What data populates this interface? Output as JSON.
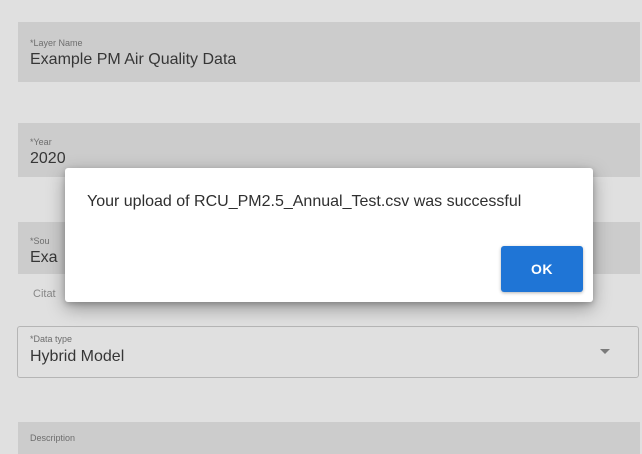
{
  "form": {
    "layer_name": {
      "label": "*Layer Name",
      "value": "Example PM Air Quality Data"
    },
    "year": {
      "label": "*Year",
      "value": "2020"
    },
    "source": {
      "label": "*Sou",
      "value": "Exa"
    },
    "citation_helper": "Citat",
    "data_type": {
      "label": "*Data type",
      "value": "Hybrid Model"
    },
    "description": {
      "label": "Description",
      "value": ""
    }
  },
  "dialog": {
    "message": "Your upload of RCU_PM2.5_Annual_Test.csv was successful",
    "ok_label": "OK"
  },
  "colors": {
    "field_bg": "#e9e9e9",
    "ok_button": "#1f75d6"
  }
}
